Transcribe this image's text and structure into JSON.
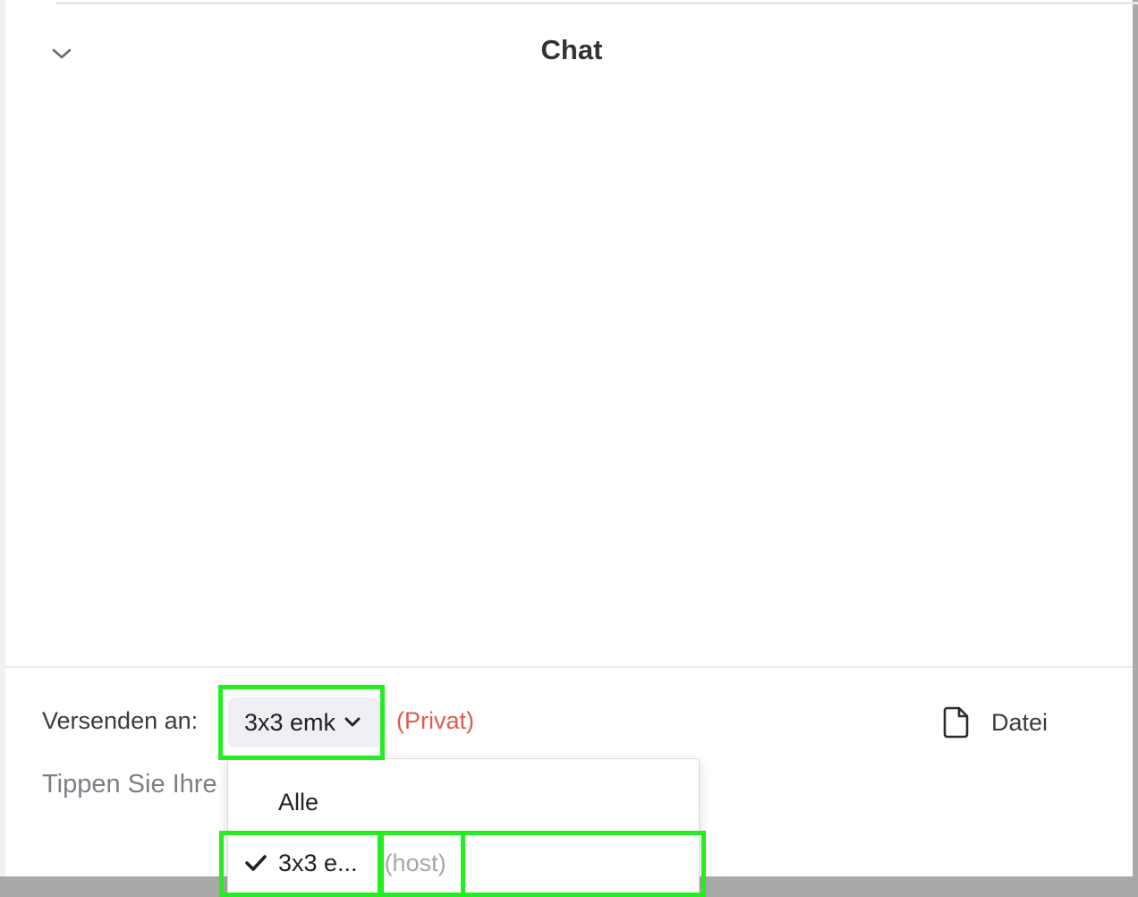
{
  "chat": {
    "title": "Chat"
  },
  "composer": {
    "send_to_label": "Versenden an:",
    "recipient_selected": "3x3 emk",
    "privacy_label": "(Privat)",
    "file_label": "Datei",
    "message_placeholder": "Tippen Sie Ihre"
  },
  "recipient_dropdown": {
    "items": [
      {
        "label": "Alle",
        "selected": false,
        "role": ""
      },
      {
        "label": "3x3 e...",
        "selected": true,
        "role": "(host)"
      }
    ]
  },
  "colors": {
    "privacy": "#e05a4f",
    "highlight": "#22ee22",
    "select_bg": "#eef0f5"
  },
  "icons": {
    "collapse": "chevron-down-icon",
    "select": "chevron-down-icon",
    "file": "file-icon",
    "selected": "check-icon"
  }
}
